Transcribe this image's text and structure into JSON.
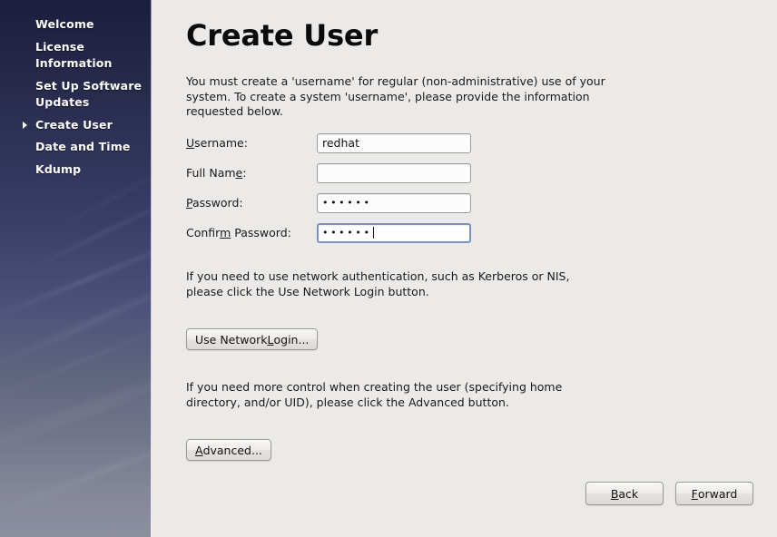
{
  "sidebar": {
    "items": [
      {
        "label": "Welcome",
        "current": false
      },
      {
        "label": "License Information",
        "current": false
      },
      {
        "label": "Set Up Software Updates",
        "current": false
      },
      {
        "label": "Create User",
        "current": true
      },
      {
        "label": "Date and Time",
        "current": false
      },
      {
        "label": "Kdump",
        "current": false
      }
    ],
    "current_marker_icon": "arrow-right-icon",
    "gradient_top_color": "#1b1e3d",
    "gradient_bottom_color": "#8c8f9e"
  },
  "main": {
    "title": "Create User",
    "intro_text": "You must create a 'username' for regular (non-administrative) use of your\nsystem.  To create a system 'username', please provide the information\nrequested below.",
    "form": {
      "fields": [
        {
          "label_prefix": "U",
          "label_mnemonic": "U",
          "label_before": "",
          "label_after": "sername:",
          "label_full": "Username:",
          "value": "redhat",
          "placeholder": "",
          "type": "text",
          "focused": false
        },
        {
          "label_mnemonic": "e",
          "label_before": "Full Nam",
          "label_after": ":",
          "label_full": "Full Name:",
          "value": "",
          "placeholder": "",
          "type": "text",
          "focused": false
        },
        {
          "label_mnemonic": "P",
          "label_before": "",
          "label_after": "assword:",
          "label_full": "Password:",
          "value": "••••••",
          "masked_char_count": 6,
          "placeholder": "",
          "type": "password",
          "focused": false
        },
        {
          "label_mnemonic": "m",
          "label_before": "Confir",
          "label_after": " Password:",
          "label_full": "Confirm Password:",
          "value": "••••••",
          "masked_char_count": 6,
          "placeholder": "",
          "type": "password",
          "focused": true
        }
      ]
    },
    "network_paragraph": "If you need to use network authentication, such as Kerberos or NIS,\nplease click the Use Network Login button.",
    "network_button": {
      "label_before": "Use Network ",
      "label_mnemonic": "L",
      "label_after": "ogin...",
      "label_full": "Use Network Login..."
    },
    "advanced_paragraph": "If you need more control when creating the user (specifying home\ndirectory, and/or UID), please click the Advanced button.",
    "advanced_button": {
      "label_before": "",
      "label_mnemonic": "A",
      "label_after": "dvanced...",
      "label_full": "Advanced..."
    }
  },
  "footer": {
    "back_button": {
      "label_before": "",
      "label_mnemonic": "B",
      "label_after": "ack",
      "label_full": "Back"
    },
    "forward_button": {
      "label_before": "",
      "label_mnemonic": "F",
      "label_after": "orward",
      "label_full": "Forward"
    }
  },
  "colors": {
    "content_background": "#eceae8",
    "field_border": "#9b9b97",
    "field_focus_border": "#7d93bb",
    "text": "#1a1a1a"
  }
}
